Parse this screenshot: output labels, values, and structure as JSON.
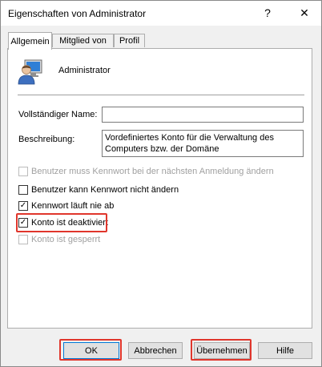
{
  "window": {
    "title": "Eigenschaften von Administrator",
    "help_glyph": "?",
    "close_glyph": "✕"
  },
  "tabs": [
    {
      "label": "Allgemein",
      "active": true
    },
    {
      "label": "Mitglied von",
      "active": false
    },
    {
      "label": "Profil",
      "active": false
    }
  ],
  "user": {
    "name": "Administrator",
    "icon": "user-monitor-icon"
  },
  "fields": {
    "full_name_label": "Vollständiger Name:",
    "full_name_value": "",
    "description_label": "Beschreibung:",
    "description_value": "Vordefiniertes Konto für die Verwaltung des Computers bzw. der Domäne"
  },
  "checkboxes": [
    {
      "label": "Benutzer muss Kennwort bei der nächsten Anmeldung ändern",
      "checked": false,
      "enabled": false
    },
    {
      "label": "Benutzer kann Kennwort nicht ändern",
      "checked": false,
      "enabled": true
    },
    {
      "label": "Kennwort läuft nie ab",
      "checked": true,
      "enabled": true
    },
    {
      "label": "Konto ist deaktiviert",
      "checked": true,
      "enabled": true
    },
    {
      "label": "Konto ist gesperrt",
      "checked": false,
      "enabled": false
    }
  ],
  "buttons": {
    "ok": "OK",
    "cancel": "Abbrechen",
    "apply": "Übernehmen",
    "help": "Hilfe"
  },
  "colors": {
    "highlight": "#e0362c",
    "default_button_border": "#0078d7"
  }
}
